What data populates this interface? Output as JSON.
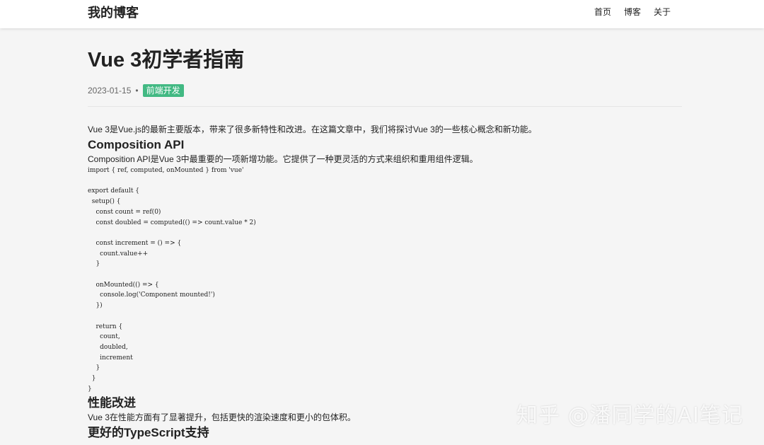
{
  "header": {
    "site_title": "我的博客",
    "nav": [
      "首页",
      "博客",
      "关于"
    ]
  },
  "post": {
    "title": "Vue 3初学者指南",
    "date": "2023-01-15",
    "separator": "•",
    "tag": "前端开发",
    "intro": "Vue 3是Vue.js的最新主要版本，带来了很多新特性和改进。在这篇文章中，我们将探讨Vue 3的一些核心概念和新功能。",
    "section1": {
      "heading": "Composition API",
      "text": "Composition API是Vue 3中最重要的一项新增功能。它提供了一种更灵活的方式来组织和重用组件逻辑。",
      "code": "import { ref, computed, onMounted } from 'vue'\n\nexport default {\n  setup() {\n    const count = ref(0)\n    const doubled = computed(() => count.value * 2)\n\n    const increment = () => {\n      count.value++\n    }\n\n    onMounted(() => {\n      console.log('Component mounted!')\n    })\n\n    return {\n      count,\n      doubled,\n      increment\n    }\n  }\n}"
    },
    "section2": {
      "heading": "性能改进",
      "text": "Vue 3在性能方面有了显著提升，包括更快的渲染速度和更小的包体积。"
    },
    "section3": {
      "heading": "更好的TypeScript支持"
    }
  },
  "colors": {
    "tag_bg": "#42b983",
    "page_bg": "#f5f5f5",
    "header_bg": "#ffffff"
  },
  "watermark": "知乎 @潘同学的AI笔记"
}
